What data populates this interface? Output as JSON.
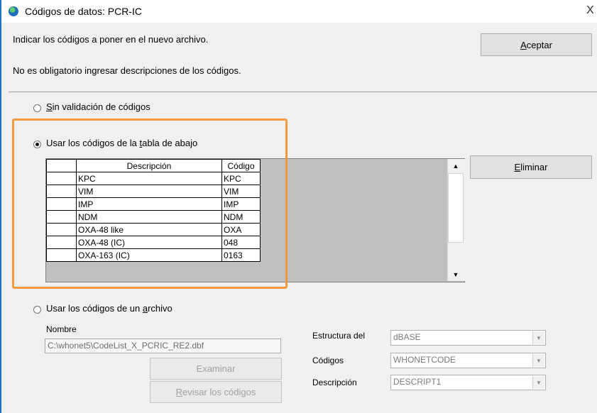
{
  "window": {
    "title": "Códigos de datos:  PCR-IC",
    "close": "X"
  },
  "instructions": {
    "line1": "Indicar los códigos a poner en el nuevo archivo.",
    "line2": "No es obligatorio ingresar descripciones de los códigos."
  },
  "buttons": {
    "accept": {
      "prefix": "",
      "mnemonic": "A",
      "rest": "ceptar"
    },
    "delete": {
      "prefix": "",
      "mnemonic": "E",
      "rest": "liminar"
    },
    "examine": "Examinar",
    "review": {
      "prefix": "",
      "mnemonic": "R",
      "rest": "evisar los códigos"
    }
  },
  "options": {
    "no_validation": {
      "prefix": "",
      "mnemonic": "S",
      "rest": "in validación de códigos",
      "checked": false
    },
    "use_table": {
      "prefix": "Usar los códigos de la ",
      "mnemonic": "t",
      "rest": "abla de abajo",
      "checked": true
    },
    "use_file": {
      "prefix": "Usar los códigos de un ",
      "mnemonic": "a",
      "rest": "rchivo",
      "checked": false
    }
  },
  "grid": {
    "headers": [
      "Descripción",
      "Código"
    ],
    "rows": [
      [
        "KPC",
        "KPC"
      ],
      [
        "VIM",
        "VIM"
      ],
      [
        "IMP",
        "IMP"
      ],
      [
        "NDM",
        "NDM"
      ],
      [
        "OXA-48 like",
        "OXA"
      ],
      [
        "OXA-48 (IC)",
        "048"
      ],
      [
        "OXA-163 (IC)",
        "0163"
      ]
    ]
  },
  "file": {
    "name_label": "Nombre",
    "name_value": "C:\\whonet5\\CodeList_X_PCRIC_RE2.dbf",
    "structure_label": "Estructura del",
    "structure_value": "dBASE",
    "codes_label": "Códigos",
    "codes_value": "WHONETCODE",
    "description_label": "Descripción",
    "description_value": "DESCRIPT1"
  },
  "colors": {
    "highlight": "#f39a3c",
    "titlebar_accent": "#1c74c9"
  }
}
